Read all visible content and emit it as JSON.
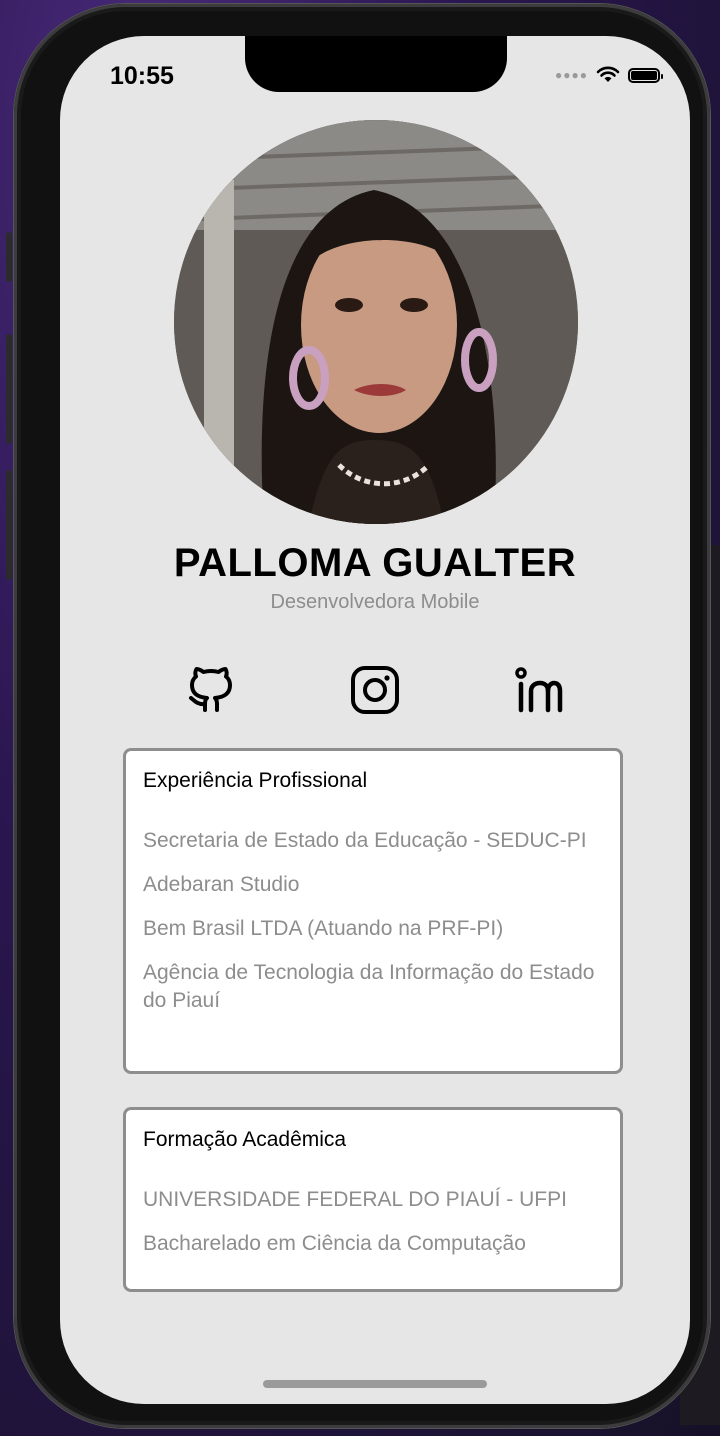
{
  "status_bar": {
    "time": "10:55"
  },
  "profile": {
    "name": "PALLOMA GUALTER",
    "role": "Desenvolvedora Mobile"
  },
  "socials": [
    {
      "icon": "github-icon"
    },
    {
      "icon": "instagram-icon"
    },
    {
      "icon": "linkedin-icon"
    }
  ],
  "experience": {
    "title": "Experiência Profissional",
    "items": [
      "Secretaria de Estado da Educação - SEDUC-PI",
      "Adebaran Studio",
      "Bem Brasil LTDA (Atuando na PRF-PI)",
      "Agência de Tecnologia da Informação do Estado do Piauí"
    ]
  },
  "education": {
    "title": "Formação Acadêmica",
    "items": [
      "UNIVERSIDADE FEDERAL DO PIAUÍ - UFPI",
      "Bacharelado em Ciência da Computação"
    ]
  }
}
